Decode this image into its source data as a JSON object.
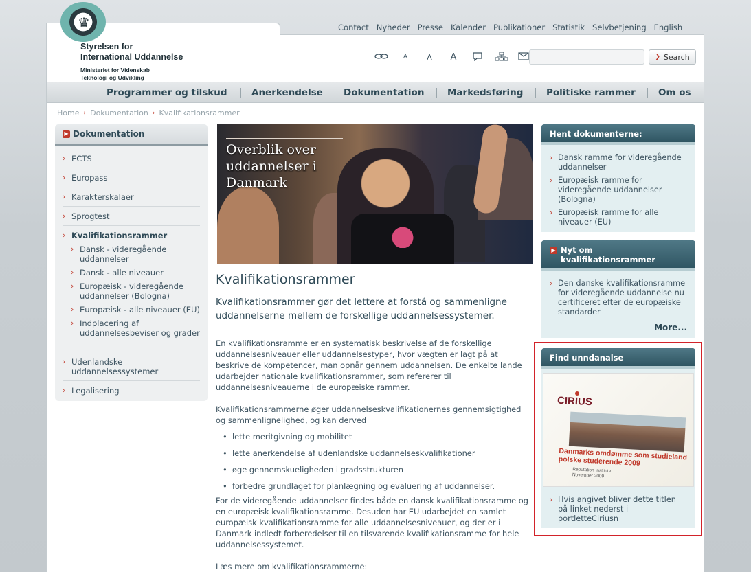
{
  "logo": {
    "name_line1": "Styrelsen for",
    "name_line2": "International Uddannelse",
    "ministry_line1": "Ministeriet for Videnskab",
    "ministry_line2": "Teknologi og Udvikling"
  },
  "top_links": [
    "Contact",
    "Nyheder",
    "Presse",
    "Kalender",
    "Publikationer",
    "Statistik",
    "Selvbetjening",
    "English"
  ],
  "tools": {
    "link_icon": "link-icon",
    "font_small": "A",
    "font_medium": "A",
    "font_large": "A",
    "comment_icon": "comment-icon",
    "sitemap_icon": "sitemap-icon",
    "mail_icon": "mail-icon",
    "print_icon": "print-icon"
  },
  "search": {
    "placeholder": "",
    "button_label": "Search"
  },
  "main_nav": [
    "Programmer og tilskud",
    "Anerkendelse",
    "Dokumentation",
    "Markedsføring",
    "Politiske rammer",
    "Om os"
  ],
  "breadcrumb": [
    "Home",
    "Dokumentation",
    "Kvalifikationsrammer"
  ],
  "left_nav": {
    "title": "Dokumentation",
    "items": [
      "ECTS",
      "Europass",
      "Karakterskalaer",
      "Sprogtest",
      "Kvalifikationsrammer"
    ],
    "sub_items": [
      "Dansk - videregående uddannelser",
      "Dansk - alle niveauer",
      "Europæisk - videregående uddannelser (Bologna)",
      "Europæisk - alle niveauer (EU)",
      "Indplacering af uddannelsesbeviser og grader"
    ],
    "items_after": [
      "Udenlandske uddannelsessystemer",
      "Legalisering"
    ]
  },
  "hero": {
    "title": "Overblik over uddannelser i Danmark"
  },
  "content": {
    "heading": "Kvalifikationsrammer",
    "lead": "Kvalifikationsrammer gør det lettere at forstå og sammenligne uddannelserne mellem de forskellige uddannelsessystemer.",
    "para1": "En kvalifikationsramme er en systematisk beskrivelse af de forskellige uddannelsesniveauer eller uddannelsestyper, hvor vægten er lagt på at beskrive de kompetencer, man opnår gennem uddannelsen. De enkelte lande udarbejder nationale kvalifikationsrammer, som refererer til uddannelsesniveauerne i de europæiske rammer.",
    "para2": "Kvalifikationsrammerne øger uddannelseskvalifikationernes gennemsigtighed og sammenlignelighed, og kan derved",
    "bullets": [
      "lette meritgivning og mobilitet",
      "lette anerkendelse af udenlandske uddannelseskvalifikationer",
      "øge gennemskueligheden i gradsstrukturen",
      "forbedre grundlaget for planlægning og evaluering af uddannelser."
    ],
    "para3": "For de videregående uddannelser findes både en dansk kvalifikationsramme og en europæisk kvalifikationsramme. Desuden har EU udarbejdet en samlet europæisk kvalifikationsramme for alle uddannelsesniveauer, og der er i Danmark indledt forberedelser til en tilsvarende kvalifikationsramme for hele uddannelsessystemet.",
    "para4": "Læs mere om kvalifikationsrammerne:"
  },
  "right": {
    "box1": {
      "title": "Hent dokumenterne:",
      "items": [
        "Dansk ramme for videregående uddannelser",
        "Europæisk ramme for videregående uddannelser (Bologna)",
        "Europæisk ramme for alle niveauer (EU)"
      ]
    },
    "box2": {
      "title": "Nyt om kvalifikationsrammer",
      "items": [
        "Den danske kvalifikationsramme for videregående uddannelse nu certificeret efter de europæiske standarder"
      ],
      "more": "More..."
    },
    "box3": {
      "title": "Find unndanalse",
      "cover_brand": "CIRIUS",
      "cover_title": "Danmarks omdømme som studieland polske studerende 2009",
      "cover_sub_line1": "Reputation Institute",
      "cover_sub_line2": "November 2009",
      "items": [
        "Hvis angivet bliver dette titlen på linket nederst i portletteCiriusn"
      ]
    }
  },
  "colors": {
    "accent_red": "#c0392b",
    "nav_text": "#2f4a57",
    "box_head": "#3d6572",
    "highlight": "#d2232a"
  }
}
